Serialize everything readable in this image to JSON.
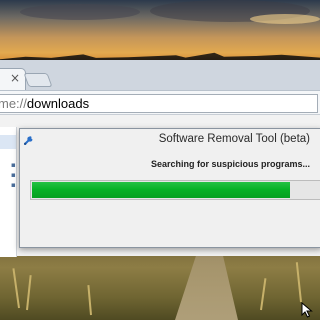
{
  "browser": {
    "tab_close_glyph": "×",
    "address_scheme": "me://",
    "address_path": "downloads"
  },
  "dialog": {
    "title": "Software Removal Tool (beta)",
    "status": "Searching for suspicious programs...",
    "progress_fraction": 0.89,
    "progress_color": "#06b025",
    "icon": "wrench-icon"
  },
  "colors": {
    "browser_frame": "#cfd6df",
    "dialog_bg": "#f0f0f0",
    "accent_blue": "#2a6fc9"
  }
}
